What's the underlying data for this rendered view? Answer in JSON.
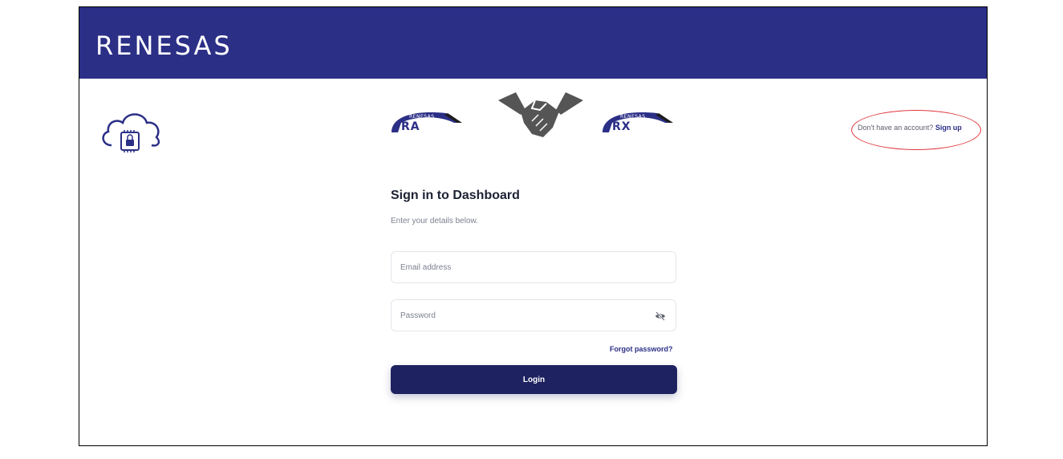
{
  "header": {
    "brand": "RENESAS"
  },
  "logos": {
    "left_brand": "RENESAS",
    "left_product": "RA",
    "right_brand": "RENESAS",
    "right_product": "RX"
  },
  "signup": {
    "prompt": "Don't have an account?",
    "link_label": "Sign up"
  },
  "form": {
    "title": "Sign in to Dashboard",
    "subtitle": "Enter your details below.",
    "email_placeholder": "Email address",
    "password_placeholder": "Password",
    "forgot_label": "Forgot password?",
    "login_label": "Login"
  },
  "icons": {
    "cloud": "cloud-lock-chip-icon",
    "handshake": "handshake-icon",
    "password_toggle": "eye-slash-icon"
  },
  "colors": {
    "brand_blue": "#2b2f86",
    "button_navy": "#1f2260",
    "annotation_red": "#e0393e"
  }
}
